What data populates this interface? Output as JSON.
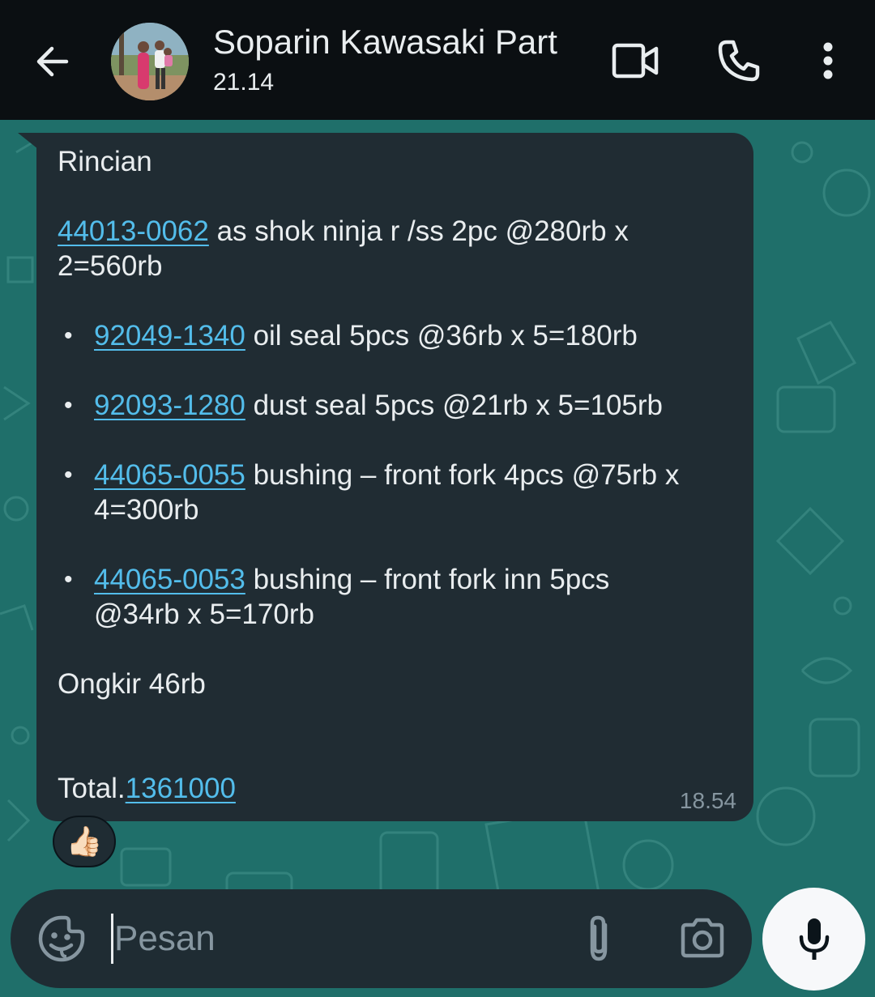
{
  "header": {
    "contact_name": "Soparin Kawasaki Part",
    "status": "21.14",
    "icons": [
      "back-arrow-icon",
      "video-call-icon",
      "voice-call-icon",
      "more-options-icon"
    ]
  },
  "message": {
    "heading": "Rincian",
    "first_item": {
      "code": "44013-0062",
      "text_line1": " as shok ninja r /ss 2pc @280rb x",
      "text_line2": "2=560rb"
    },
    "bullets": [
      {
        "code": "92049-1340",
        "text_line1": " oil seal 5pcs @36rb x 5=180rb",
        "text_line2": ""
      },
      {
        "code": "92093-1280",
        "text_line1": " dust seal 5pcs @21rb x 5=105rb",
        "text_line2": ""
      },
      {
        "code": "44065-0055",
        "text_line1": " bushing – front fork 4pcs @75rb x",
        "text_line2": "4=300rb"
      },
      {
        "code": "44065-0053",
        "text_line1": " bushing – front fork inn 5pcs",
        "text_line2": "@34rb x 5=170rb"
      }
    ],
    "bullet_symbol": "•",
    "shipping": "Ongkir 46rb",
    "total_label": "Total.",
    "total_value": "1361000",
    "time": "18.54"
  },
  "reaction": {
    "emoji": "👍🏻"
  },
  "composer": {
    "placeholder": "Pesan",
    "icons": [
      "emoji-sticker-icon",
      "attachment-icon",
      "camera-icon",
      "microphone-icon"
    ]
  },
  "colors": {
    "header_bg": "#0b0f12",
    "chat_bg": "#1f6f6a",
    "bubble_bg": "#202c33",
    "text": "#e9edef",
    "link": "#53bdeb",
    "muted": "#8696a0",
    "mic_button_bg": "#f7f8fa"
  }
}
